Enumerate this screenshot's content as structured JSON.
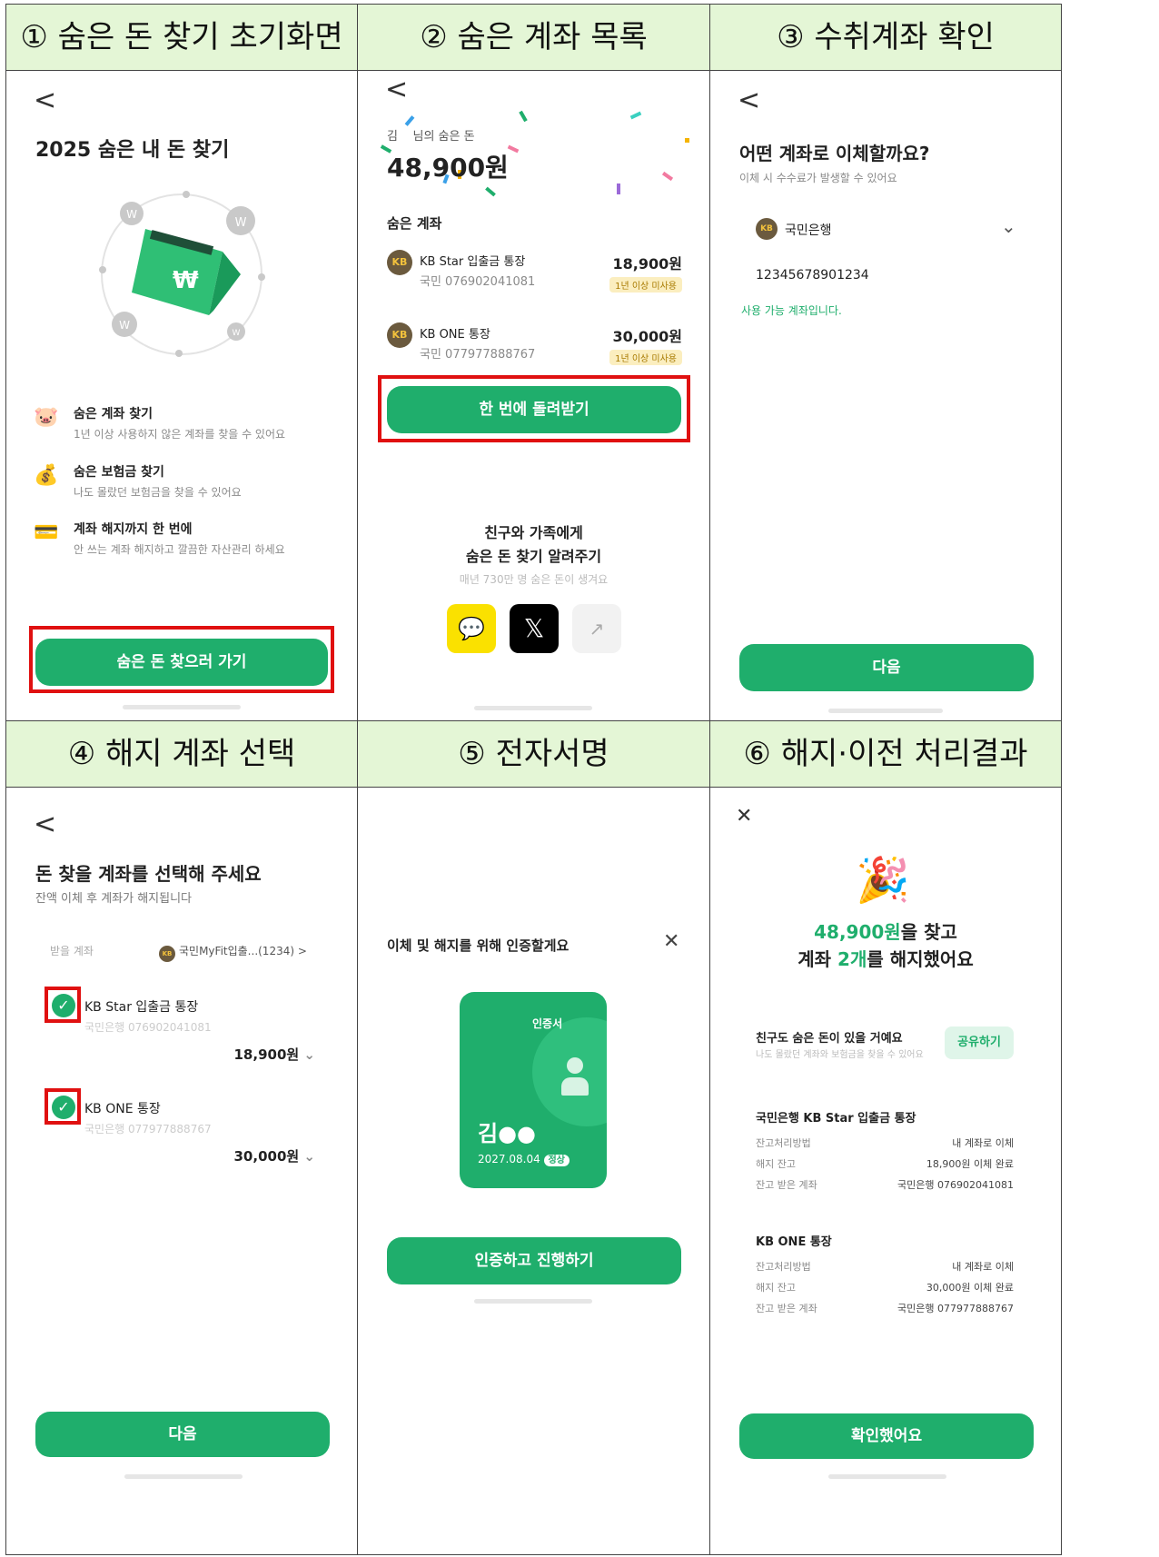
{
  "panels": [
    {
      "number": "①",
      "title": "숨은 돈 찾기 초기화면"
    },
    {
      "number": "②",
      "title": "숨은 계좌 목록"
    },
    {
      "number": "③",
      "title": "수취계좌 확인"
    },
    {
      "number": "④",
      "title": "해지 계좌 선택"
    },
    {
      "number": "⑤",
      "title": "전자서명"
    },
    {
      "number": "⑥",
      "title": "해지·이전 처리결과"
    }
  ],
  "s1": {
    "back": "<",
    "title": "2025 숨은 내 돈 찾기",
    "features": [
      {
        "icon": "piggy-icon",
        "title": "숨은 계좌 찾기",
        "desc": "1년 이상 사용하지 않은 계좌를 찾을 수 있어요"
      },
      {
        "icon": "money-bag-icon",
        "title": "숨은 보험금 찾기",
        "desc": "나도 몰랐던 보험금을 찾을 수 있어요"
      },
      {
        "icon": "card-icon",
        "title": "계좌 해지까지 한 번에",
        "desc": "안 쓰는 계좌 해지하고 깔끔한 자산관리 하세요"
      }
    ],
    "button": "숨은 돈 찾으러 가기"
  },
  "s2": {
    "back": "<",
    "user_name": "김",
    "greeting": "님의 숨은 돈",
    "total": "48,900원",
    "section": "숨은 계좌",
    "accounts": [
      {
        "name": "KB Star 입출금 통장",
        "number": "국민 076902041081",
        "amount": "18,900원",
        "tag": "1년 이상 미사용"
      },
      {
        "name": "KB ONE 통장",
        "number": "국민 077977888767",
        "amount": "30,000원",
        "tag": "1년 이상 미사용"
      }
    ],
    "button": "한 번에 돌려받기",
    "share_title_1": "친구와 가족에게",
    "share_title_2": "숨은 돈 찾기 알려주기",
    "share_desc": "매년 730만 명 숨은 돈이 생겨요"
  },
  "s3": {
    "back": "<",
    "title": "어떤 계좌로 이체할까요?",
    "subtitle": "이체 시 수수료가 발생할 수 있어요",
    "bank": "국민은행",
    "account": "12345678901234",
    "status": "사용 가능 계좌입니다.",
    "button": "다음"
  },
  "s4": {
    "back": "<",
    "title": "돈 찾을 계좌를 선택해 주세요",
    "subtitle": "잔액 이체 후 계좌가 해지됩니다",
    "receive_label": "받을 계좌",
    "receive_value": "국민MyFit입출...(1234)",
    "accounts": [
      {
        "name": "KB Star 입출금 통장",
        "number": "국민은행 076902041081",
        "amount": "18,900원"
      },
      {
        "name": "KB ONE 통장",
        "number": "국민은행 077977888767",
        "amount": "30,000원"
      }
    ],
    "button": "다음"
  },
  "s5": {
    "title": "이체 및 해지를 위해 인증할게요",
    "cert_label": "인증서",
    "cert_name": "김●●",
    "cert_date": "2027.08.04",
    "cert_status": "정상",
    "button": "인증하고 진행하기"
  },
  "s6": {
    "amount": "48,900원",
    "line1_suffix": "을 찾고",
    "line2_prefix": "계좌 ",
    "count": "2개",
    "line2_suffix": "를 해지했어요",
    "share_title": "친구도 숨은 돈이 있을 거예요",
    "share_desc": "나도 몰랐던 계좌와 보험금을 찾을 수 있어요",
    "share_button": "공유하기",
    "results": [
      {
        "title": "국민은행 KB Star 입출금 통장",
        "rows": [
          [
            "잔고처리방법",
            "내 계좌로 이체"
          ],
          [
            "해지 잔고",
            "18,900원 이체 완료"
          ],
          [
            "잔고 받은 계좌",
            "국민은행 076902041081"
          ]
        ]
      },
      {
        "title": "KB ONE 통장",
        "rows": [
          [
            "잔고처리방법",
            "내 계좌로 이체"
          ],
          [
            "해지 잔고",
            "30,000원 이체 완료"
          ],
          [
            "잔고 받은 계좌",
            "국민은행 077977888767"
          ]
        ]
      }
    ],
    "button": "확인했어요"
  },
  "colors": {
    "brand_green": "#1fae6c",
    "header_bg": "#e4f6d6",
    "highlight_red": "#e01010"
  }
}
